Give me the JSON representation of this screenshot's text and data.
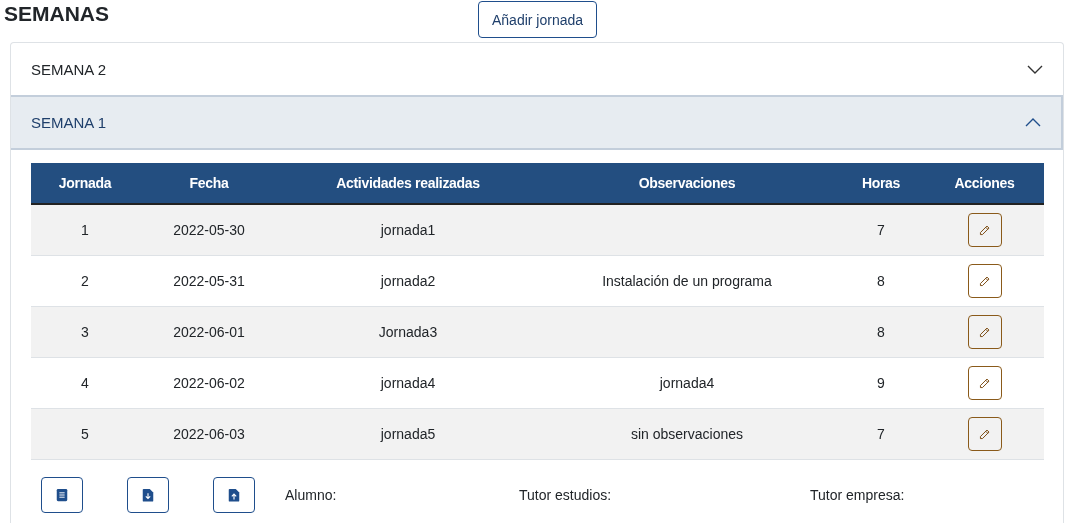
{
  "title": "SEMANAS",
  "add_button": "Añadir jornada",
  "weeks": [
    {
      "label": "SEMANA 2",
      "expanded": false
    },
    {
      "label": "SEMANA 1",
      "expanded": true,
      "table": {
        "columns": [
          "Jornada",
          "Fecha",
          "Actividades realizadas",
          "Observaciones",
          "Horas",
          "Acciones"
        ],
        "rows": [
          {
            "jornada": "1",
            "fecha": "2022-05-30",
            "actividades": "jornada1",
            "observaciones": "",
            "horas": "7"
          },
          {
            "jornada": "2",
            "fecha": "2022-05-31",
            "actividades": "jornada2",
            "observaciones": "Instalación de un programa",
            "horas": "8"
          },
          {
            "jornada": "3",
            "fecha": "2022-06-01",
            "actividades": "Jornada3",
            "observaciones": "",
            "horas": "8"
          },
          {
            "jornada": "4",
            "fecha": "2022-06-02",
            "actividades": "jornada4",
            "observaciones": "jornada4",
            "horas": "9"
          },
          {
            "jornada": "5",
            "fecha": "2022-06-03",
            "actividades": "jornada5",
            "observaciones": "sin observaciones",
            "horas": "7"
          }
        ]
      },
      "footer": {
        "buttons": [
          {
            "kind": "word"
          },
          {
            "kind": "download"
          },
          {
            "kind": "upload"
          }
        ],
        "signatures": [
          "Alumno:",
          "Tutor estudios:",
          "Tutor empresa:"
        ]
      }
    }
  ]
}
